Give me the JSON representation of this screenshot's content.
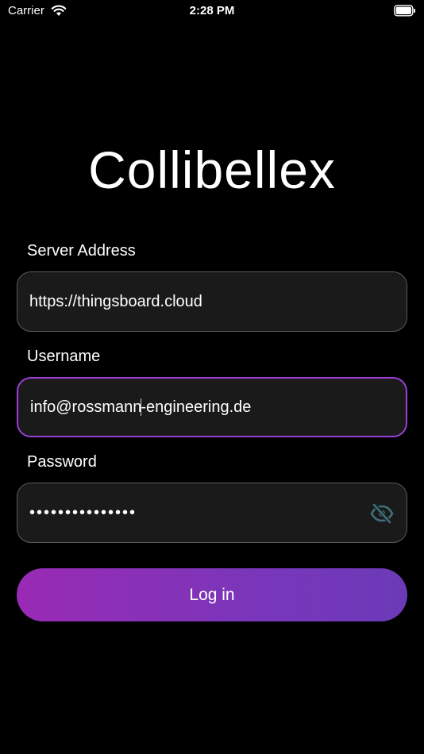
{
  "status_bar": {
    "carrier": "Carrier",
    "time": "2:28 PM",
    "icons": [
      "wifi-icon",
      "battery-icon"
    ]
  },
  "app": {
    "title": "Collibellex"
  },
  "form": {
    "server": {
      "label": "Server Address",
      "value": "https://thingsboard.cloud"
    },
    "username": {
      "label": "Username",
      "value_before_caret": "info@rossmann",
      "value_after_caret": "-engineering.de"
    },
    "password": {
      "label": "Password",
      "masked_value": "•••••••••••••••",
      "toggle_icon": "eye-slash-icon"
    },
    "login_label": "Log in"
  },
  "colors": {
    "background": "#000000",
    "field_background": "#1a1a1a",
    "field_border": "#5b5b5b",
    "focus_border": "#9b3fd6",
    "button_gradient_start": "#9a2ab5",
    "button_gradient_end": "#6b3ab8",
    "icon_muted": "#3f6f78"
  }
}
